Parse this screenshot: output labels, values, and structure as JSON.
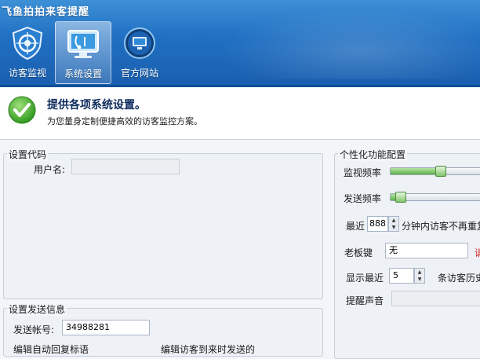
{
  "app_title": "飞鱼拍拍来客提醒",
  "nav": [
    {
      "label": "访客监视",
      "icon": "shield-target-icon",
      "active": false
    },
    {
      "label": "系统设置",
      "icon": "monitor-settings-icon",
      "active": true
    },
    {
      "label": "官方网站",
      "icon": "globe-monitor-icon",
      "active": false
    }
  ],
  "header": {
    "title": "提供各项系统设置。",
    "subtitle": "为您量身定制便捷高效的访客监控方案。"
  },
  "settings_code": {
    "legend": "设置代码",
    "username_label": "用户名:",
    "username_value": ""
  },
  "send_info": {
    "legend": "设置发送信息",
    "account_label": "发送帐号:",
    "account_value": "34988281",
    "line2_left": "编辑自动回复标语",
    "line2_right": "编辑访客到来时发送的"
  },
  "personalization": {
    "legend": "个性化功能配置",
    "monitor_freq_label": "监视频率",
    "monitor_freq_level": 0.5,
    "send_freq_label": "发送频率",
    "send_freq_level": 0.1,
    "recent_prefix": "最近",
    "recent_minutes": "888",
    "recent_suffix": "分钟内访客不再重复",
    "boss_key_label": "老板键",
    "boss_key_value": "无",
    "boss_key_hint": "请",
    "show_recent_prefix": "显示最近",
    "show_recent_value": "5",
    "show_recent_suffix": "条访客历史",
    "alert_sound_label": "提醒声音"
  },
  "colors": {
    "banner": "#1f6fc2",
    "accent_green": "#5bb248",
    "hint_red": "#d02020"
  }
}
